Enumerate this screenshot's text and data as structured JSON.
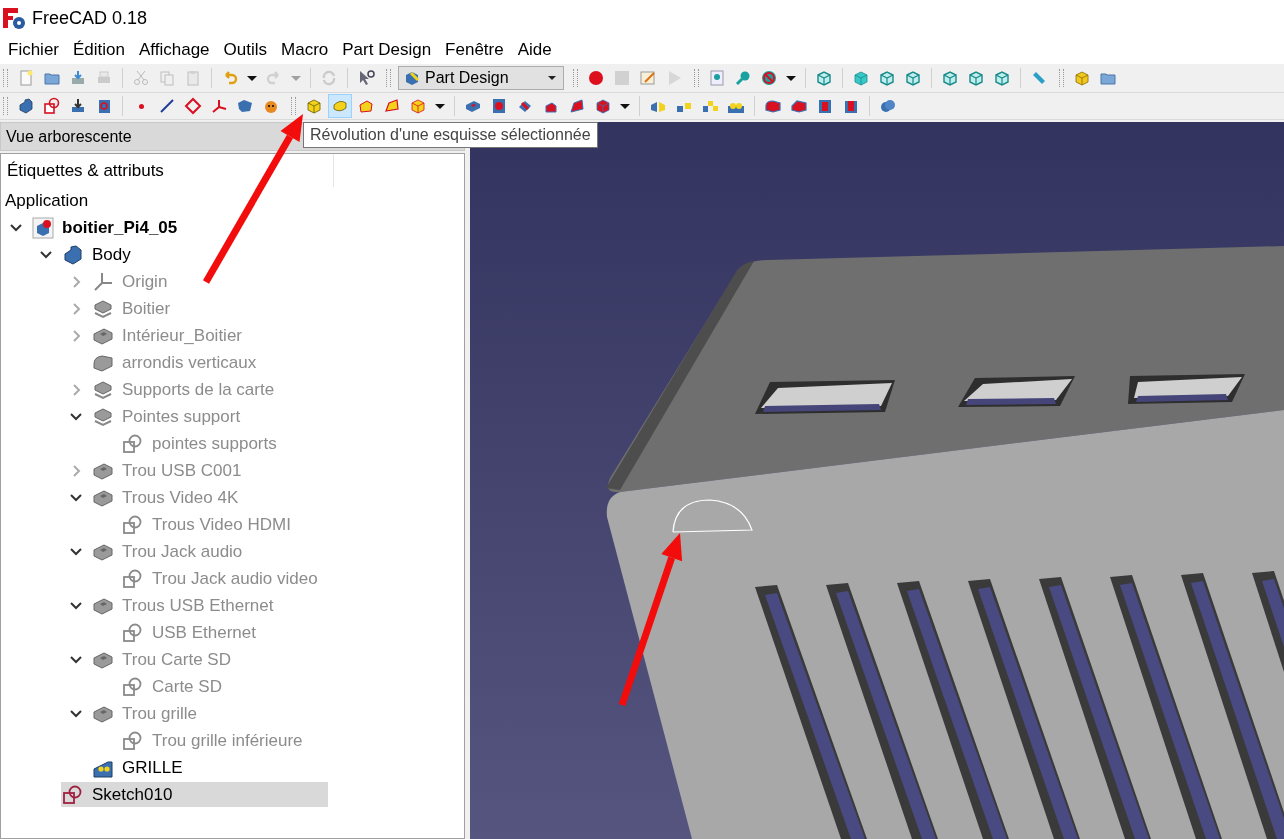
{
  "window": {
    "title": "FreeCAD 0.18"
  },
  "menu": [
    "Fichier",
    "Édition",
    "Affichage",
    "Outils",
    "Macro",
    "Part Design",
    "Fenêtre",
    "Aide"
  ],
  "toolbar_rows": [
    [
      {
        "groups": [
          [
            {
              "kind": "new",
              "disabled": false,
              "hovered": false
            },
            {
              "kind": "open",
              "disabled": false,
              "hovered": false
            },
            {
              "kind": "save",
              "disabled": false,
              "hovered": false
            },
            {
              "kind": "print",
              "disabled": true,
              "hovered": false
            }
          ],
          [
            {
              "kind": "cut",
              "disabled": true,
              "hovered": false
            },
            {
              "kind": "copy",
              "disabled": true,
              "hovered": false
            },
            {
              "kind": "paste",
              "disabled": true,
              "hovered": false
            }
          ],
          [
            {
              "kind": "undo",
              "disabled": false,
              "hovered": false
            },
            {
              "kind": "caret",
              "disabled": false,
              "hovered": false
            },
            {
              "kind": "redo",
              "disabled": true,
              "hovered": false
            },
            {
              "kind": "caret",
              "disabled": true,
              "hovered": false
            }
          ],
          [
            {
              "kind": "refresh",
              "disabled": true,
              "hovered": false
            }
          ],
          [
            {
              "kind": "whatsthis",
              "disabled": false,
              "hovered": false
            }
          ]
        ]
      },
      {
        "groups": [
          [
            {
              "kind": "combo",
              "label": "Part Design"
            }
          ]
        ]
      },
      {
        "groups": [
          [
            {
              "kind": "record",
              "disabled": false,
              "hovered": false
            },
            {
              "kind": "stop",
              "disabled": true,
              "hovered": false
            },
            {
              "kind": "macro",
              "disabled": false,
              "hovered": false
            },
            {
              "kind": "play",
              "disabled": true,
              "hovered": false
            }
          ]
        ]
      },
      {
        "groups": [
          [
            {
              "kind": "fitall",
              "disabled": false,
              "hovered": false
            },
            {
              "kind": "fitsel",
              "disabled": false,
              "hovered": false
            },
            {
              "kind": "drawstyle",
              "disabled": false,
              "hovered": false
            },
            {
              "kind": "caret",
              "disabled": false,
              "hovered": false
            }
          ],
          [
            {
              "kind": "iso",
              "disabled": false,
              "hovered": false
            }
          ],
          [
            {
              "kind": "front",
              "disabled": false,
              "hovered": false
            },
            {
              "kind": "top",
              "disabled": false,
              "hovered": false
            },
            {
              "kind": "right",
              "disabled": false,
              "hovered": false
            }
          ],
          [
            {
              "kind": "rear",
              "disabled": false,
              "hovered": false
            },
            {
              "kind": "bottom",
              "disabled": false,
              "hovered": false
            },
            {
              "kind": "left",
              "disabled": false,
              "hovered": false
            }
          ],
          [
            {
              "kind": "measure",
              "disabled": false,
              "hovered": false
            }
          ]
        ]
      },
      {
        "groups": [
          [
            {
              "kind": "part",
              "disabled": false,
              "hovered": false
            },
            {
              "kind": "folder",
              "disabled": false,
              "hovered": false
            }
          ]
        ]
      }
    ],
    [
      {
        "groups": [
          [
            {
              "kind": "body",
              "disabled": false,
              "hovered": false
            },
            {
              "kind": "sketch",
              "disabled": false,
              "hovered": false
            },
            {
              "kind": "import",
              "disabled": false,
              "hovered": false
            },
            {
              "kind": "clone",
              "disabled": false,
              "hovered": false
            }
          ],
          [
            {
              "kind": "point",
              "disabled": false,
              "hovered": false
            },
            {
              "kind": "line",
              "disabled": false,
              "hovered": false
            },
            {
              "kind": "plane",
              "disabled": false,
              "hovered": false
            },
            {
              "kind": "lcs",
              "disabled": false,
              "hovered": false
            },
            {
              "kind": "binder",
              "disabled": false,
              "hovered": false
            },
            {
              "kind": "subbinder",
              "disabled": false,
              "hovered": false
            }
          ]
        ]
      },
      {
        "groups": [
          [
            {
              "kind": "pad",
              "disabled": false,
              "hovered": false
            },
            {
              "kind": "revolve",
              "disabled": false,
              "hovered": true
            },
            {
              "kind": "loft",
              "disabled": false,
              "hovered": false
            },
            {
              "kind": "pipe",
              "disabled": false,
              "hovered": false
            },
            {
              "kind": "prim",
              "disabled": false,
              "hovered": false
            },
            {
              "kind": "caret",
              "disabled": false,
              "hovered": false
            }
          ],
          [
            {
              "kind": "pocket",
              "disabled": false,
              "hovered": false
            },
            {
              "kind": "hole",
              "disabled": false,
              "hovered": false
            },
            {
              "kind": "groove",
              "disabled": false,
              "hovered": false
            },
            {
              "kind": "sloft",
              "disabled": false,
              "hovered": false
            },
            {
              "kind": "spipe",
              "disabled": false,
              "hovered": false
            },
            {
              "kind": "sprim",
              "disabled": false,
              "hovered": false
            },
            {
              "kind": "caret",
              "disabled": false,
              "hovered": false
            }
          ],
          [
            {
              "kind": "mirror",
              "disabled": false,
              "hovered": false
            },
            {
              "kind": "linpattern",
              "disabled": false,
              "hovered": false
            },
            {
              "kind": "polar",
              "disabled": false,
              "hovered": false
            },
            {
              "kind": "multi",
              "disabled": false,
              "hovered": false
            }
          ],
          [
            {
              "kind": "fillet",
              "disabled": false,
              "hovered": false
            },
            {
              "kind": "chamfer",
              "disabled": false,
              "hovered": false
            },
            {
              "kind": "draft",
              "disabled": false,
              "hovered": false
            },
            {
              "kind": "thick",
              "disabled": false,
              "hovered": false
            }
          ],
          [
            {
              "kind": "boolean",
              "disabled": false,
              "hovered": false
            }
          ]
        ]
      }
    ]
  ],
  "tooltip": "Révolution d'une esquisse sélectionnée",
  "panel": {
    "title": "Vue arborescente",
    "column_header": "Étiquettes & attributs"
  },
  "tree": {
    "root_label": "Application",
    "items": [
      {
        "label": "boitier_Pi4_05",
        "kind": "document",
        "expanded": true,
        "visible": true,
        "selected": false,
        "children": [
          {
            "label": "Body",
            "kind": "body",
            "expanded": true,
            "visible": true,
            "selected": false,
            "children": [
              {
                "label": "Origin",
                "kind": "origin",
                "expanded": false,
                "visible": false,
                "selected": false
              },
              {
                "label": "Boitier",
                "kind": "pad",
                "expanded": false,
                "visible": false,
                "selected": false
              },
              {
                "label": "Intérieur_Boitier",
                "kind": "pocket",
                "expanded": false,
                "visible": false,
                "selected": false
              },
              {
                "label": "arrondis verticaux",
                "kind": "fillet",
                "visible": false,
                "selected": false
              },
              {
                "label": "Supports de la carte",
                "kind": "pad",
                "expanded": false,
                "visible": false,
                "selected": false
              },
              {
                "label": "Pointes support",
                "kind": "pad",
                "expanded": true,
                "visible": false,
                "selected": false,
                "children": [
                  {
                    "label": "pointes supports",
                    "kind": "sketch",
                    "visible": false,
                    "selected": false
                  }
                ]
              },
              {
                "label": "Trou USB C001",
                "kind": "pocket",
                "expanded": false,
                "visible": false,
                "selected": false
              },
              {
                "label": "Trous Video 4K",
                "kind": "pocket",
                "expanded": true,
                "visible": false,
                "selected": false,
                "children": [
                  {
                    "label": "Trous Video HDMI",
                    "kind": "sketch",
                    "visible": false,
                    "selected": false
                  }
                ]
              },
              {
                "label": "Trou Jack audio",
                "kind": "pocket",
                "expanded": true,
                "visible": false,
                "selected": false,
                "children": [
                  {
                    "label": "Trou Jack audio video",
                    "kind": "sketch",
                    "visible": false,
                    "selected": false
                  }
                ]
              },
              {
                "label": "Trous USB Ethernet",
                "kind": "pocket",
                "expanded": true,
                "visible": false,
                "selected": false,
                "children": [
                  {
                    "label": "USB Ethernet",
                    "kind": "sketch",
                    "visible": false,
                    "selected": false
                  }
                ]
              },
              {
                "label": "Trou Carte SD",
                "kind": "pocket",
                "expanded": true,
                "visible": false,
                "selected": false,
                "children": [
                  {
                    "label": "Carte SD",
                    "kind": "sketch",
                    "visible": false,
                    "selected": false
                  }
                ]
              },
              {
                "label": "Trou grille",
                "kind": "pocket",
                "expanded": true,
                "visible": false,
                "selected": false,
                "children": [
                  {
                    "label": "Trou grille inférieure",
                    "kind": "sketch",
                    "visible": false,
                    "selected": false
                  }
                ]
              },
              {
                "label": "GRILLE",
                "kind": "multi",
                "visible": true,
                "selected": false
              }
            ]
          },
          {
            "label": "Sketch010",
            "kind": "sketch",
            "visible": true,
            "selected": true
          }
        ]
      }
    ]
  }
}
